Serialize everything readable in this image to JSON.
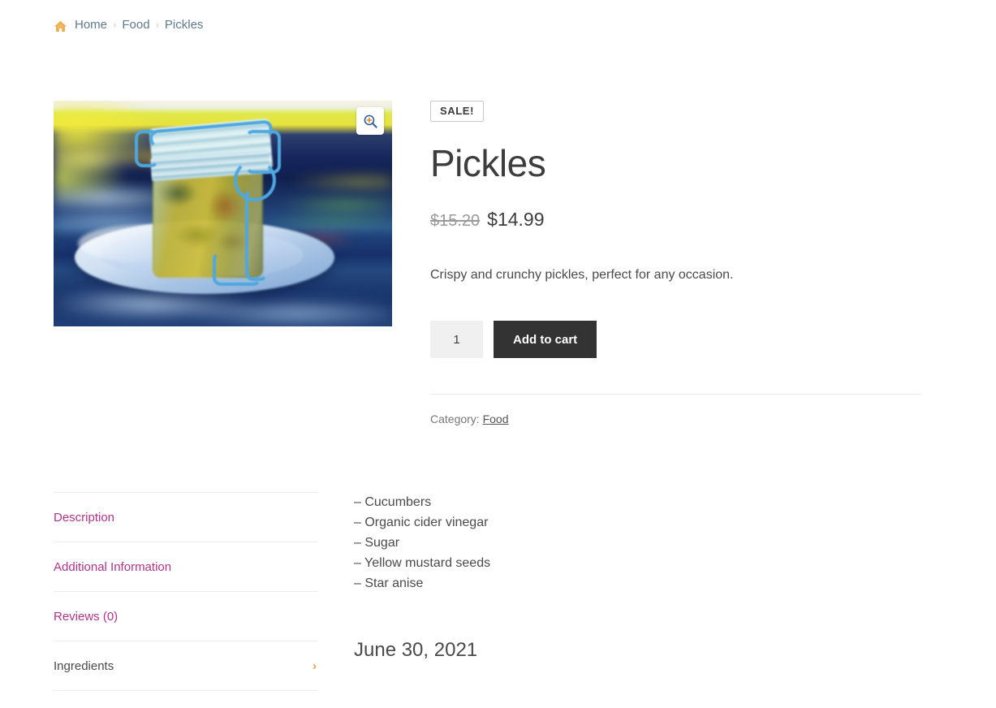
{
  "breadcrumb": {
    "home_icon": "home-icon",
    "items": [
      {
        "label": "Home",
        "type": "link"
      },
      {
        "label": "Food",
        "type": "link"
      },
      {
        "label": "Pickles",
        "type": "current"
      }
    ],
    "separator": "›"
  },
  "gallery": {
    "zoom_icon": "magnifier-plus-icon",
    "image_alt": "Glass jar of pickles with blue wire clasp on a blue saucer"
  },
  "product": {
    "sale_badge": "SALE!",
    "title": "Pickles",
    "price": {
      "regular": "$15.20",
      "sale": "$14.99"
    },
    "short_description": "Crispy and crunchy pickles, perfect for any occasion.",
    "quantity_value": "1",
    "quantity_placeholder": "1",
    "add_to_cart_label": "Add to cart",
    "meta_label": "Category:",
    "meta_category": "Food"
  },
  "tabs": [
    {
      "label": "Description",
      "active": false,
      "chevron": ""
    },
    {
      "label": "Additional Information",
      "active": false,
      "chevron": ""
    },
    {
      "label": "Reviews (0)",
      "active": false,
      "chevron": ""
    },
    {
      "label": "Ingredients",
      "active": true,
      "chevron": "›"
    }
  ],
  "panel": {
    "ingredients": [
      "– Cucumbers",
      "– Organic cider vinegar",
      "– Sugar",
      "– Yellow mustard seeds",
      "– Star anise"
    ],
    "date": "June 30, 2021"
  },
  "colors": {
    "accent_link": "#b0338a",
    "breadcrumb_text": "#5e7a8c",
    "button_bg": "#333333",
    "chevron": "#e8a13c",
    "home_icon": "#e8a13c"
  }
}
